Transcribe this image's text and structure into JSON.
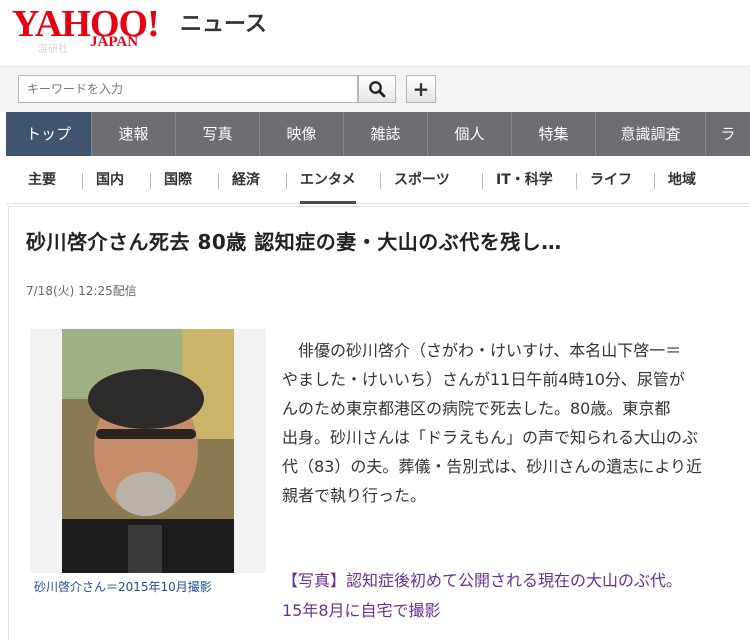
{
  "header": {
    "logo_text": "YAHOO!",
    "logo_sub": "JAPAN",
    "logo_watermark": "游研社",
    "service_name": "ニュース"
  },
  "search": {
    "placeholder": "キーワードを入力",
    "search_icon": "search-icon",
    "plus_label": "+"
  },
  "main_nav": {
    "items": [
      {
        "label": "トップ"
      },
      {
        "label": "速報"
      },
      {
        "label": "写真"
      },
      {
        "label": "映像"
      },
      {
        "label": "雑誌"
      },
      {
        "label": "個人"
      },
      {
        "label": "特集"
      },
      {
        "label": "意識調査"
      },
      {
        "label": "ラ"
      }
    ],
    "active_color": "#3f556e",
    "bar_color": "#6d6e71"
  },
  "sub_nav": {
    "items": [
      {
        "label": "主要"
      },
      {
        "label": "国内"
      },
      {
        "label": "国際"
      },
      {
        "label": "経済"
      },
      {
        "label": "エンタメ"
      },
      {
        "label": "スポーツ"
      },
      {
        "label": "IT・科学"
      },
      {
        "label": "ライフ"
      },
      {
        "label": "地域"
      }
    ]
  },
  "article": {
    "headline": "砂川啓介さん死去 80歳 認知症の妻・大山のぶ代を残し…",
    "dateline": "7/18(火) 12:25配信",
    "caption": "砂川啓介さん＝2015年10月撮影",
    "body_lines": [
      "　俳優の砂川啓介（さがわ・けいすけ、本名山下啓一＝",
      "やました・けいいち）さんが11日午前4時10分、尿管が",
      "んのため東京都港区の病院で死去した。80歳。東京都",
      "出身。砂川さんは「ドラえもん」の声で知られる大山のぶ",
      "代（83）の夫。葬儀・告別式は、砂川さんの遺志により近",
      "親者で執り行った。"
    ],
    "related_lines": [
      "【写真】認知症後初めて公開される現在の大山のぶ代。",
      "15年8月に自宅で撮影"
    ]
  },
  "colors": {
    "brand_red": "#e60012",
    "link_purple": "#6a2f8f",
    "caption_blue": "#1a4c9a"
  }
}
